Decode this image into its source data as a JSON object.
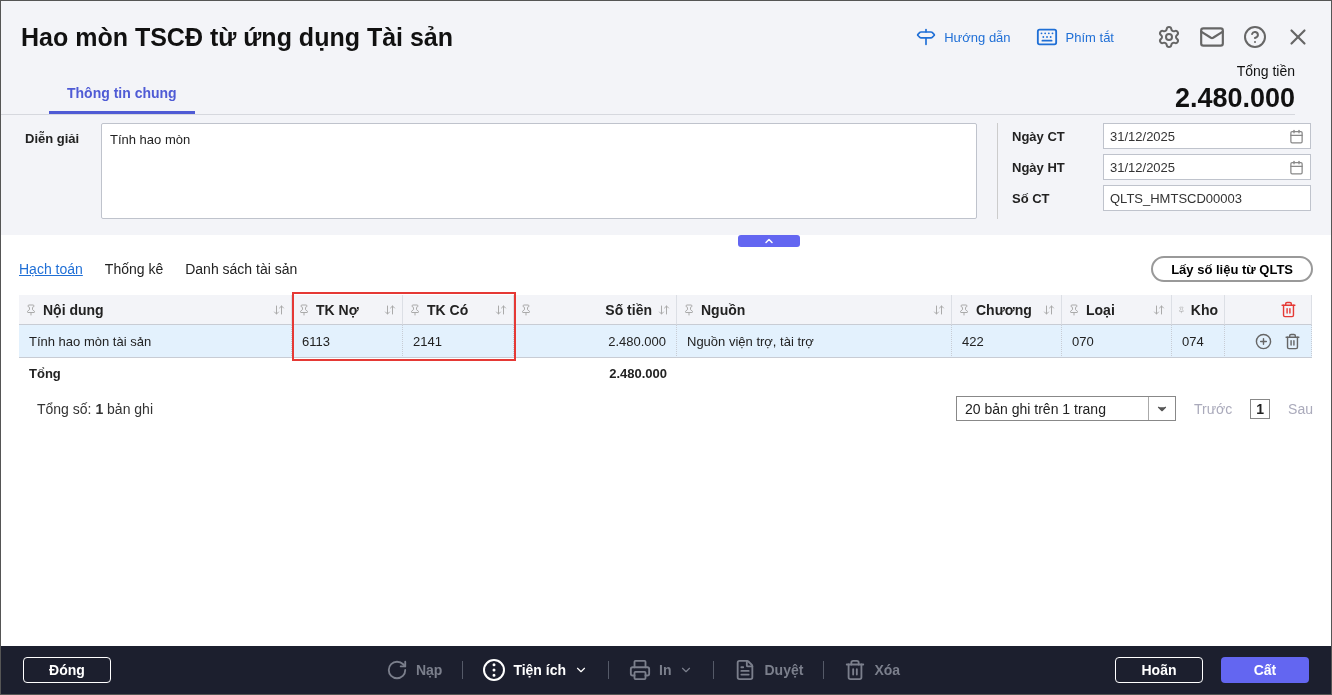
{
  "window": {
    "title": "Hao mòn TSCĐ từ ứng dụng Tài sản"
  },
  "header_links": [
    {
      "kind": "guide",
      "label": "Hướng dẫn"
    },
    {
      "kind": "shortcut",
      "label": "Phím tắt"
    }
  ],
  "header_icons": [
    {
      "kind": "settings"
    },
    {
      "kind": "mail"
    },
    {
      "kind": "help"
    },
    {
      "kind": "close"
    }
  ],
  "total": {
    "label": "Tổng tiền",
    "value": "2.480.000"
  },
  "tabs": [
    {
      "label": "Thông tin chung",
      "selected": true
    }
  ],
  "form": {
    "description": {
      "label": "Diễn giải",
      "value": "Tính hao mòn"
    },
    "fields": [
      {
        "label": "Ngày CT",
        "value": "31/12/2025",
        "kind": "date"
      },
      {
        "label": "Ngày HT",
        "value": "31/12/2025",
        "kind": "date"
      },
      {
        "label": "Số CT",
        "value": "QLTS_HMTSCD00003",
        "kind": "text"
      }
    ]
  },
  "sub_tabs": [
    {
      "label": "Hạch toán",
      "selected": true
    },
    {
      "label": "Thống kê",
      "selected": false
    },
    {
      "label": "Danh sách tài sản",
      "selected": false
    }
  ],
  "fetch_button": "Lấy số liệu từ QLTS",
  "table": {
    "columns": [
      {
        "label": "Nội dung",
        "kind": "text",
        "highlighted": false
      },
      {
        "label": "TK Nợ",
        "kind": "text",
        "highlighted": true
      },
      {
        "label": "TK Có",
        "kind": "text",
        "highlighted": true
      },
      {
        "label": "Số tiền",
        "kind": "amount",
        "highlighted": false
      },
      {
        "label": "Nguồn",
        "kind": "text",
        "highlighted": false
      },
      {
        "label": "Chương",
        "kind": "text",
        "highlighted": false
      },
      {
        "label": "Loại",
        "kind": "text",
        "highlighted": false
      },
      {
        "label": "Kho",
        "kind": "text",
        "highlighted": false
      }
    ],
    "rows": [
      {
        "cells": [
          "Tính hao mòn tài sản",
          "6113",
          "2141",
          "2.480.000",
          "Nguồn viện trợ, tài trợ",
          "422",
          "070",
          "074"
        ],
        "selected": true
      }
    ],
    "total_row": {
      "label": "Tổng",
      "amount": "2.480.000"
    }
  },
  "record_count": {
    "label": "Tổng số:",
    "count": "1",
    "unit": "bản ghi"
  },
  "pagination": {
    "page_size": "20 bản ghi trên 1 trang",
    "prev": "Trước",
    "page": "1",
    "next": "Sau",
    "prev_disabled": true,
    "next_disabled": true
  },
  "footer": {
    "close": "Đóng",
    "actions": [
      {
        "kind": "reload",
        "label": "Nạp",
        "disabled": true
      },
      {
        "kind": "utility",
        "label": "Tiện ích",
        "disabled": false
      },
      {
        "kind": "print",
        "label": "In",
        "disabled": true
      },
      {
        "kind": "approve",
        "label": "Duyệt",
        "disabled": true
      },
      {
        "kind": "delete",
        "label": "Xóa",
        "disabled": true
      }
    ],
    "cancel": "Hoãn",
    "save": "Cất"
  }
}
